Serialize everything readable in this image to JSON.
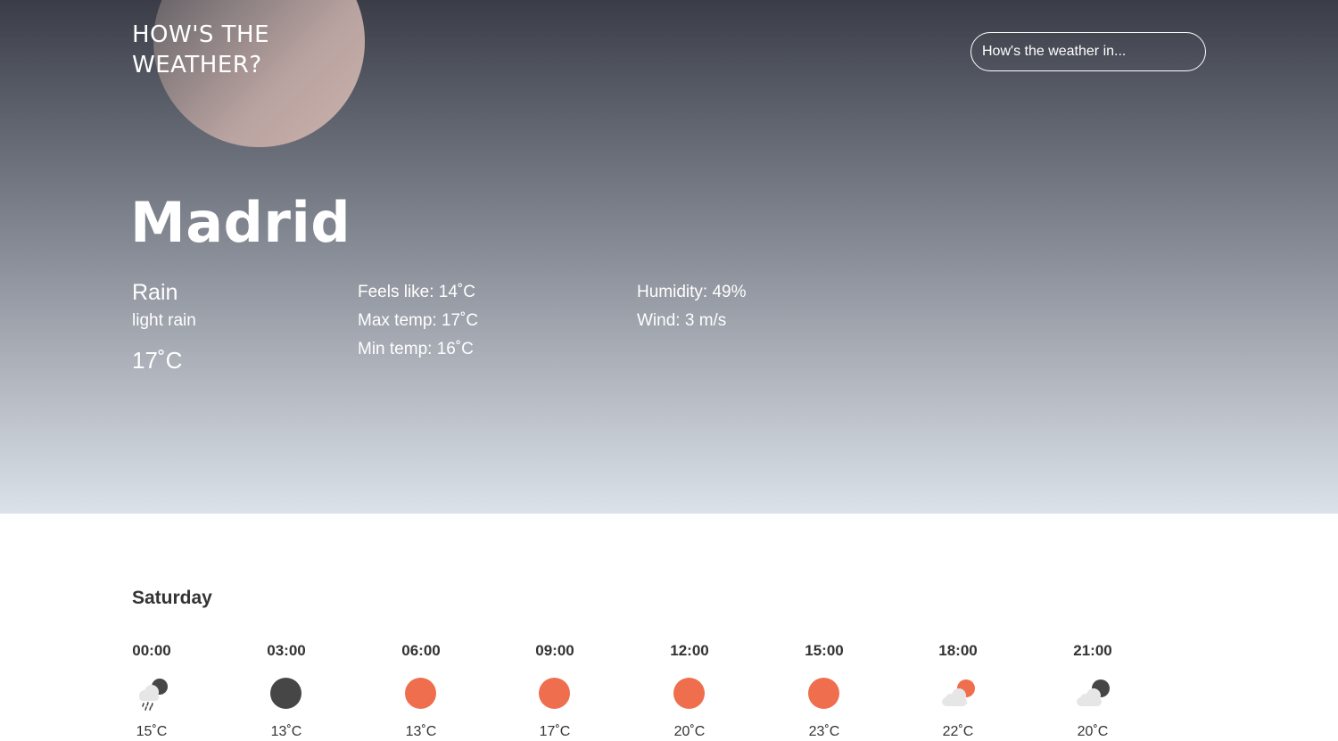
{
  "header": {
    "logo_text": "HOW'S THE\nWEATHER?",
    "search_placeholder": "How's the weather in..."
  },
  "current": {
    "city": "Madrid",
    "condition": "Rain",
    "description": "light rain",
    "temperature": "17˚C",
    "feels_like": "Feels like: 14˚C",
    "max_temp": "Max temp: 17˚C",
    "min_temp": "Min temp: 16˚C",
    "humidity": "Humidity: 49%",
    "wind": "Wind: 3 m/s"
  },
  "forecast": {
    "day": "Saturday",
    "slots": [
      {
        "time": "00:00",
        "icon": "night-rain-icon",
        "temp": "15˚C"
      },
      {
        "time": "03:00",
        "icon": "clear-night-icon",
        "temp": "13˚C"
      },
      {
        "time": "06:00",
        "icon": "sun-icon",
        "temp": "13˚C"
      },
      {
        "time": "09:00",
        "icon": "sun-icon",
        "temp": "17˚C"
      },
      {
        "time": "12:00",
        "icon": "sun-icon",
        "temp": "20˚C"
      },
      {
        "time": "15:00",
        "icon": "sun-icon",
        "temp": "23˚C"
      },
      {
        "time": "18:00",
        "icon": "partly-cloudy-day-icon",
        "temp": "22˚C"
      },
      {
        "time": "21:00",
        "icon": "partly-cloudy-night-icon",
        "temp": "20˚C"
      }
    ]
  },
  "colors": {
    "sun": "#ee6e4d",
    "night": "#464646",
    "cloud": "#e6e6e6",
    "text_dark": "#333333"
  }
}
